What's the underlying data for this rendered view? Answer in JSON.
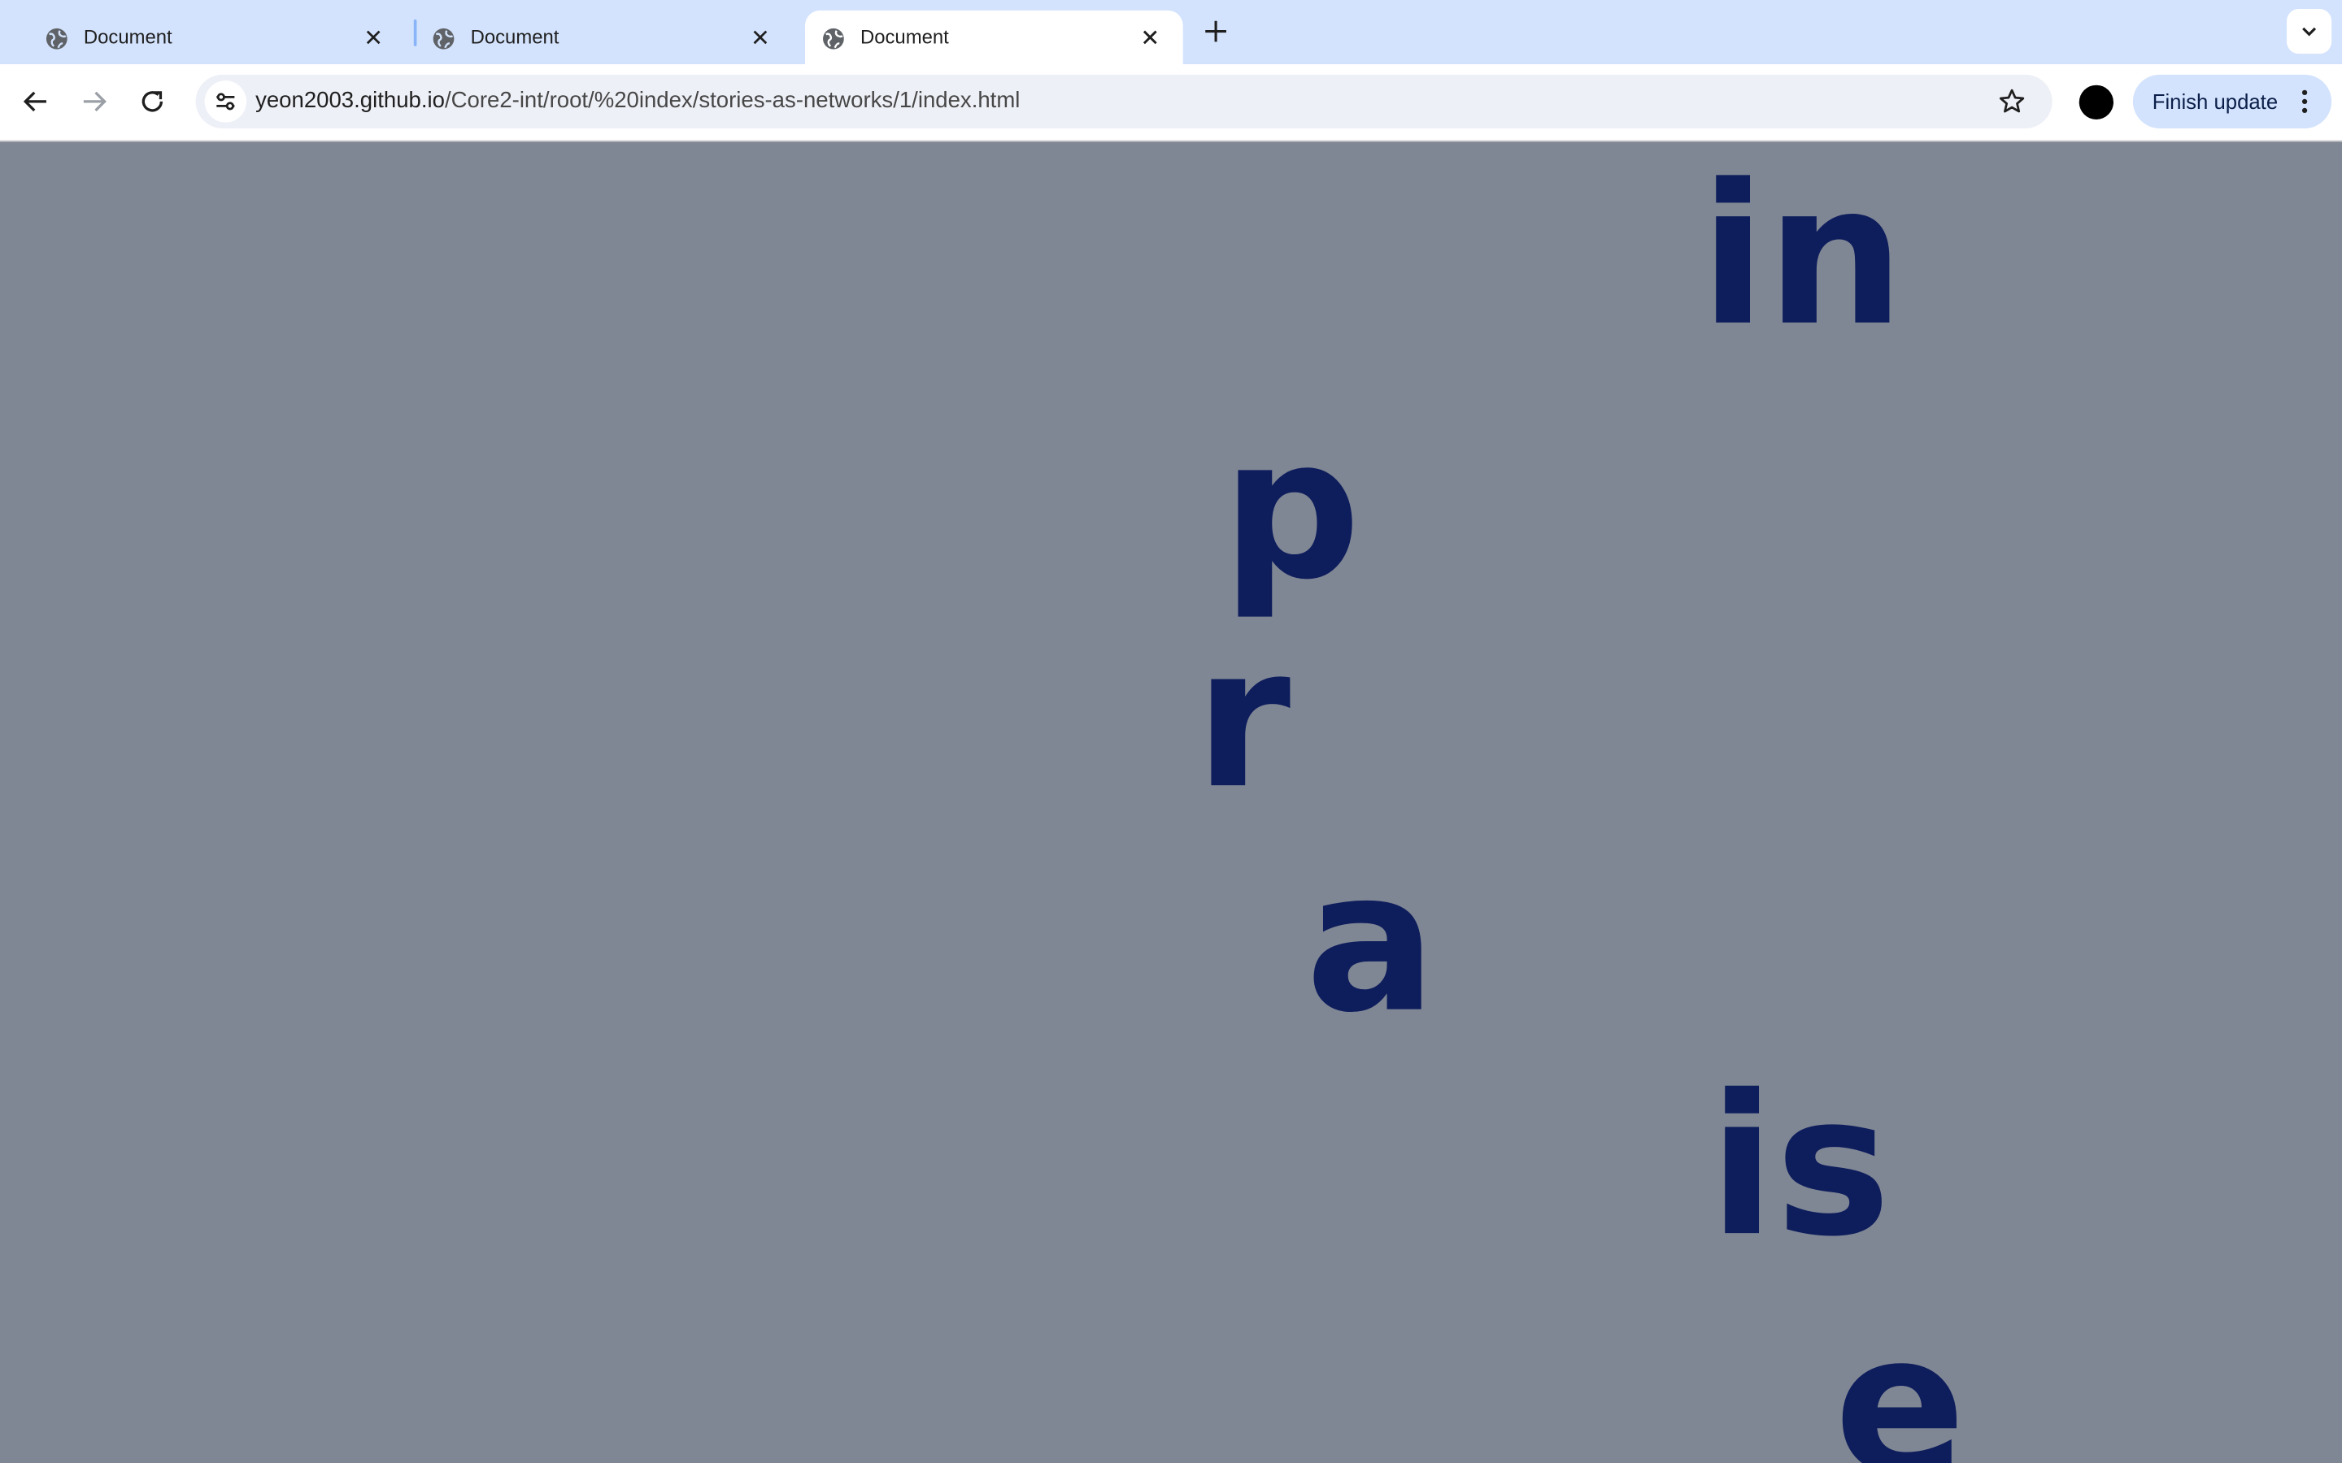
{
  "tabs": [
    {
      "title": "Document",
      "favicon": "globe-icon",
      "active": false
    },
    {
      "title": "Document",
      "favicon": "globe-icon",
      "active": false
    },
    {
      "title": "Document",
      "favicon": "globe-icon",
      "active": true
    }
  ],
  "address_bar": {
    "url_host": "yeon2003.github.io",
    "url_path": "/Core2-int/root/%20index/stories-as-networks/1/index.html"
  },
  "toolbar": {
    "update_button_label": "Finish update"
  },
  "page": {
    "background_color": "#7f8694",
    "text_color": "#0e1d5c",
    "words": [
      "in",
      "p",
      "r",
      "a",
      "is",
      "e"
    ]
  }
}
